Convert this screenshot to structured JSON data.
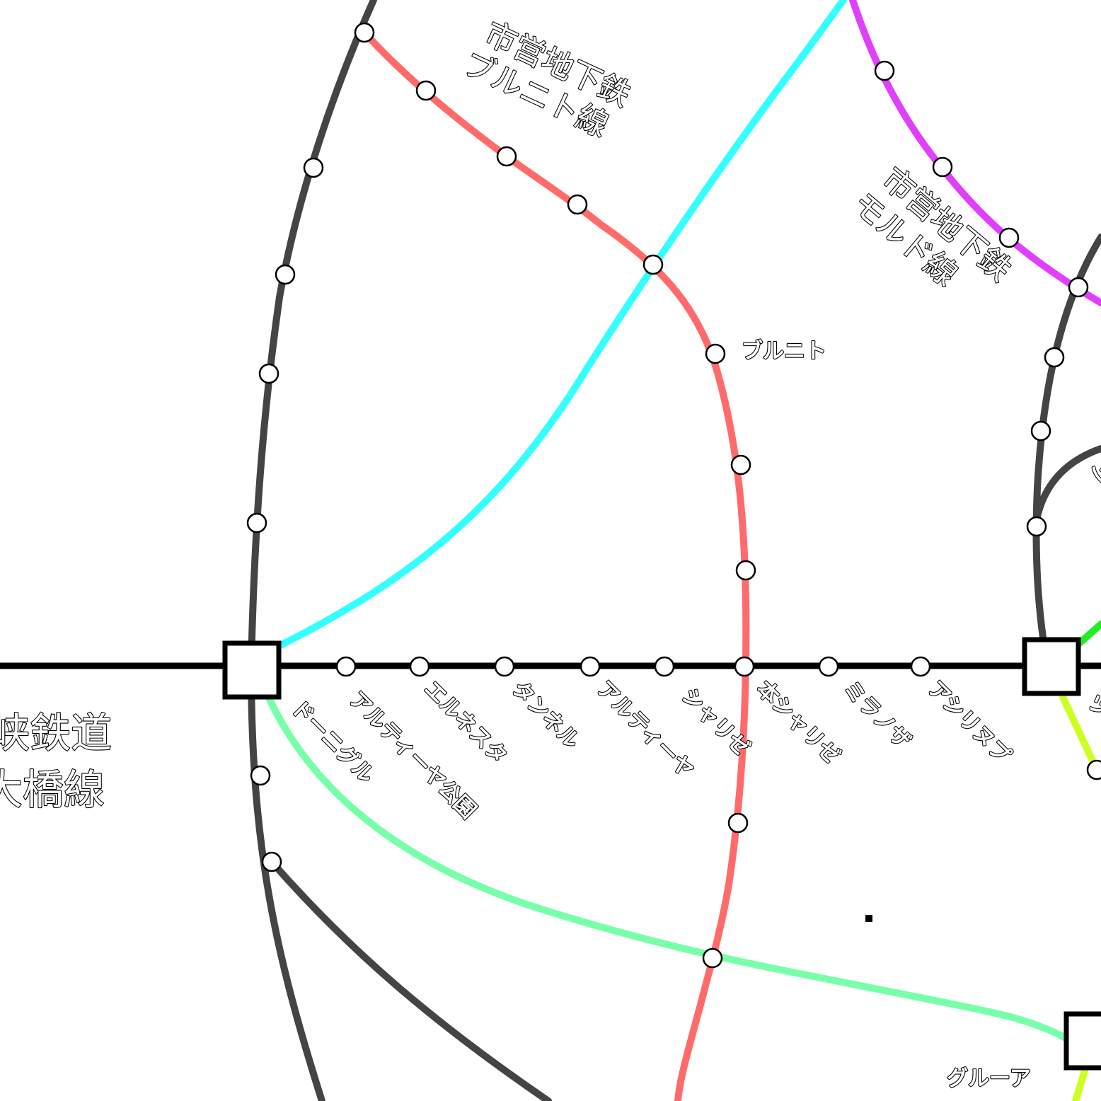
{
  "lines": [
    {
      "id": "hyobashi",
      "name_lines": [
        "峡鉄道",
        "大橋線"
      ],
      "color": "#000000"
    },
    {
      "id": "brunito",
      "name_lines": [
        "市営地下鉄",
        "ブルニト線"
      ],
      "color": "#ff6b6b"
    },
    {
      "id": "moldo",
      "name_lines": [
        "市営地下鉄",
        "モルド線"
      ],
      "color": "#e040fb"
    },
    {
      "id": "loop",
      "color": "#444444"
    },
    {
      "id": "cyan",
      "color": "#33ffff"
    },
    {
      "id": "mint",
      "color": "#77ffaa"
    },
    {
      "id": "green",
      "color": "#22ee22"
    },
    {
      "id": "lime",
      "color": "#ccff22"
    }
  ],
  "stations": {
    "brunito": "ブルニト",
    "main_line": [
      "アルティーヤ公園",
      "エルネスタ",
      "タンネル",
      "アルティーヤ",
      "シャリゼ",
      "本シャリゼ",
      "ミラノザ",
      "アシリヌプ"
    ],
    "dorniguru": "ドーニグル",
    "gurua": "グルーア",
    "partial_right_top": "シ",
    "partial_right_bottom": "ツ"
  }
}
